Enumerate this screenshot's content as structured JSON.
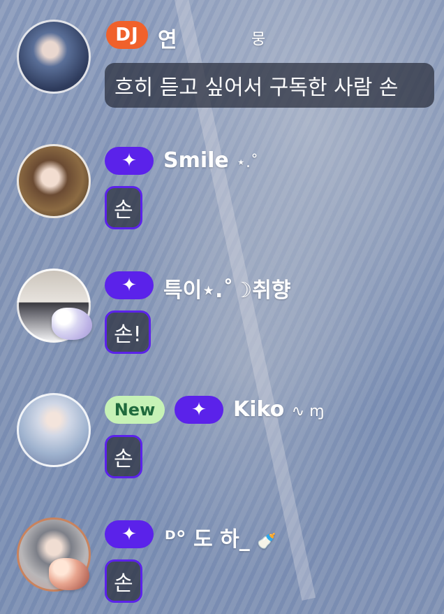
{
  "messages": [
    {
      "badges": [
        {
          "type": "dj",
          "label": "DJ"
        }
      ],
      "name": "연",
      "name_suffix": "뭉",
      "text": "흐히 듣고 싶어서 구독한 사람 손"
    },
    {
      "badges": [
        {
          "type": "star",
          "label": "✦"
        }
      ],
      "name": "Smile",
      "name_suffix": "⋆.˚",
      "text": "손"
    },
    {
      "badges": [
        {
          "type": "star",
          "label": "✦"
        }
      ],
      "name": "특이⋆.˚☽취향",
      "name_suffix": "",
      "text": "손!"
    },
    {
      "badges": [
        {
          "type": "new",
          "label": "New"
        },
        {
          "type": "star",
          "label": "✦"
        }
      ],
      "name": "Kiko",
      "name_suffix": "∿ ɱ",
      "text": "손"
    },
    {
      "badges": [
        {
          "type": "star",
          "label": "✦"
        }
      ],
      "name": "ᴰ° 도 하_",
      "name_suffix": "🍼",
      "text": "손"
    }
  ],
  "colors": {
    "dj_badge": "#f0612b",
    "star_badge": "#5b22ea",
    "new_badge": "#c6f2b6",
    "bubble_bg": "#2c2f3a"
  }
}
